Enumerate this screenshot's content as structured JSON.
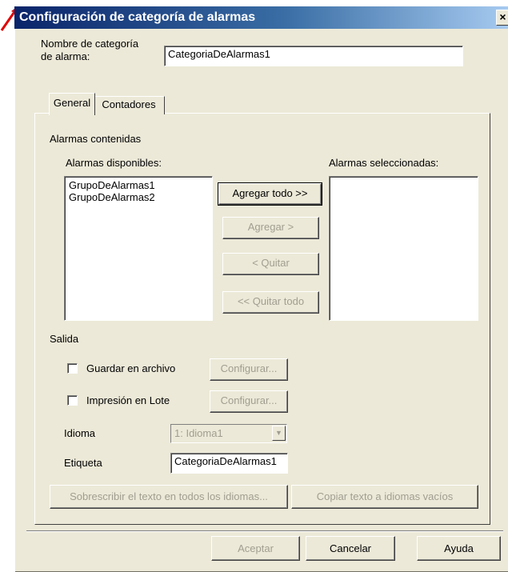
{
  "window": {
    "title": "Configuración de categoría de alarmas",
    "close_glyph": "×"
  },
  "category_name": {
    "label_line1": "Nombre de categoría",
    "label_line2": "de alarma:",
    "value": "CategoriaDeAlarmas1"
  },
  "tabs": [
    {
      "label": "General",
      "active": true
    },
    {
      "label": "Contadores",
      "active": false
    }
  ],
  "alarms": {
    "group_label": "Alarmas contenidas",
    "available_label": "Alarmas disponibles:",
    "available_items": [
      "GrupoDeAlarmas1",
      "GrupoDeAlarmas2"
    ],
    "selected_label": "Alarmas seleccionadas:",
    "selected_items": [],
    "buttons": {
      "add_all": "Agregar todo >>",
      "add": "Agregar >",
      "remove": "< Quitar",
      "remove_all": "<< Quitar todo"
    }
  },
  "output": {
    "label": "Salida",
    "save_to_file": {
      "label": "Guardar en archivo",
      "checked": false,
      "configure": "Configurar..."
    },
    "batch_print": {
      "label": "Impresión en Lote",
      "checked": false,
      "configure": "Configurar..."
    },
    "language_label": "Idioma",
    "language_value": "1: Idioma1",
    "tag_label": "Etiqueta",
    "tag_value": "CategoriaDeAlarmas1",
    "overwrite_button": "Sobrescribir el texto en todos los idiomas...",
    "copy_button": "Copiar texto a idiomas vacíos"
  },
  "footer": {
    "accept": "Aceptar",
    "cancel": "Cancelar",
    "help": "Ayuda"
  },
  "colors": {
    "dialog_bg": "#ece9d8",
    "title_bar_start": "#0a246a",
    "disabled_text": "#a19e91",
    "pointer": "#e00000"
  }
}
